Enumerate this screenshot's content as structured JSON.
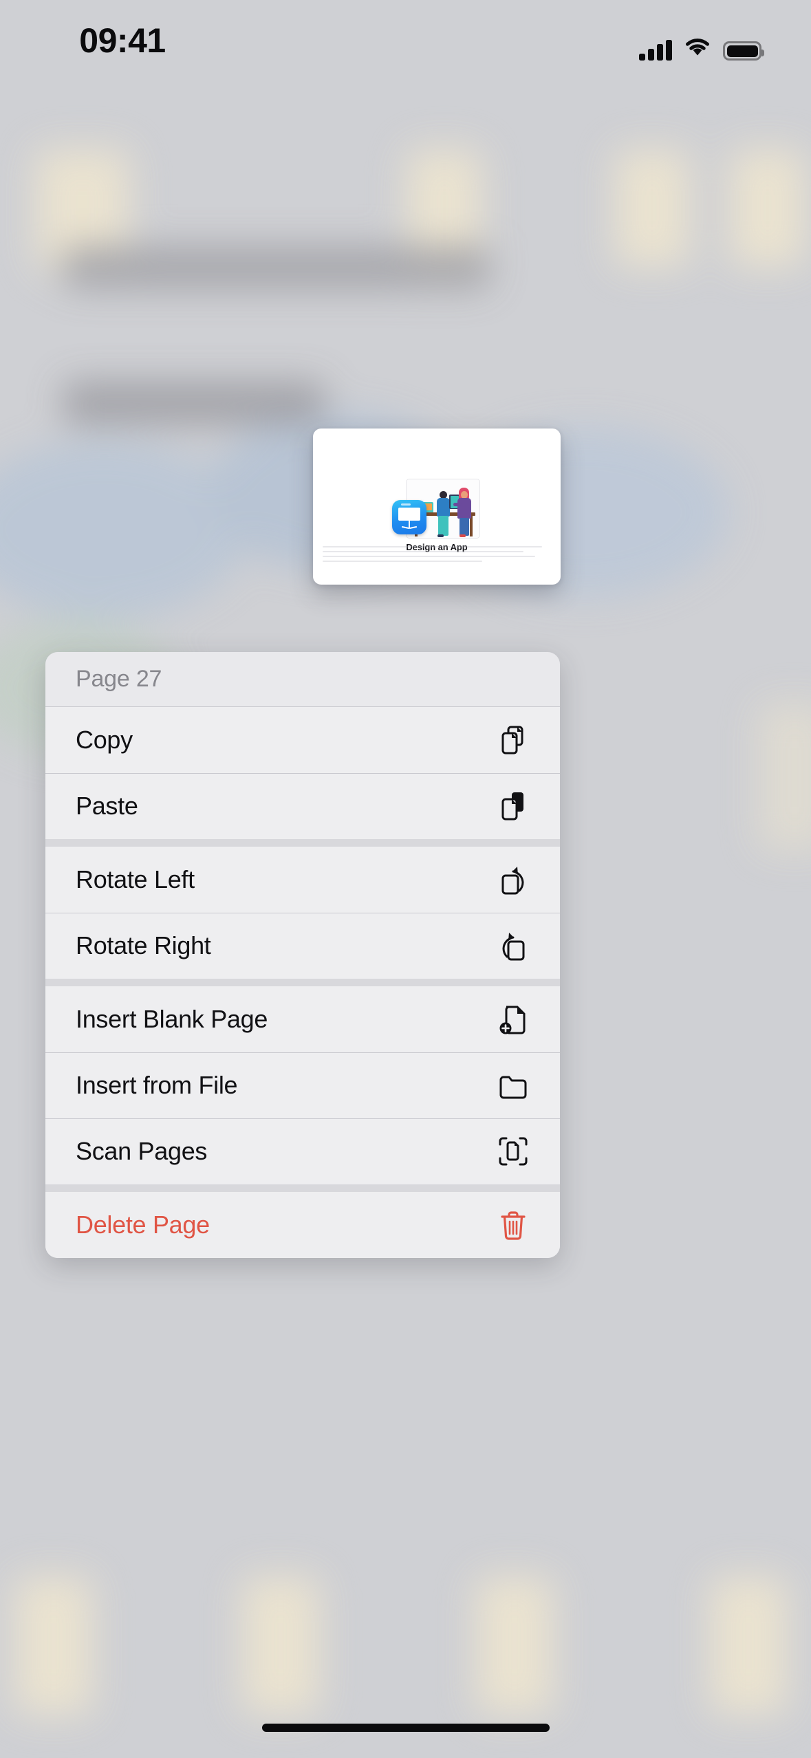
{
  "status_bar": {
    "time": "09:41",
    "cellular_icon": "cellular-bars-icon",
    "wifi_icon": "wifi-icon",
    "battery_icon": "battery-full-icon"
  },
  "preview": {
    "title": "Design an App",
    "slide_icon": "keynote-app-icon",
    "illustration": "two-people-at-desk-illustration"
  },
  "context_menu": {
    "header": "Page 27",
    "groups": [
      {
        "items": [
          {
            "label": "Copy",
            "icon": "doc-on-doc-icon",
            "destructive": false
          },
          {
            "label": "Paste",
            "icon": "doc-on-clipboard-fill-icon",
            "destructive": false
          }
        ]
      },
      {
        "items": [
          {
            "label": "Rotate Left",
            "icon": "rotate-left-icon",
            "destructive": false
          },
          {
            "label": "Rotate Right",
            "icon": "rotate-right-icon",
            "destructive": false
          }
        ]
      },
      {
        "items": [
          {
            "label": "Insert Blank Page",
            "icon": "doc-badge-plus-icon",
            "destructive": false
          },
          {
            "label": "Insert from File",
            "icon": "folder-icon",
            "destructive": false
          },
          {
            "label": "Scan Pages",
            "icon": "doc-viewfinder-icon",
            "destructive": false
          }
        ]
      },
      {
        "items": [
          {
            "label": "Delete Page",
            "icon": "trash-icon",
            "destructive": true
          }
        ]
      }
    ]
  },
  "colors": {
    "destructive": "#e05545",
    "menu_background": "#eeeef0",
    "separator": "#c9c9cf",
    "header_text": "#87878d",
    "backdrop": "#cfd0d4"
  },
  "home_indicator": "home-indicator"
}
